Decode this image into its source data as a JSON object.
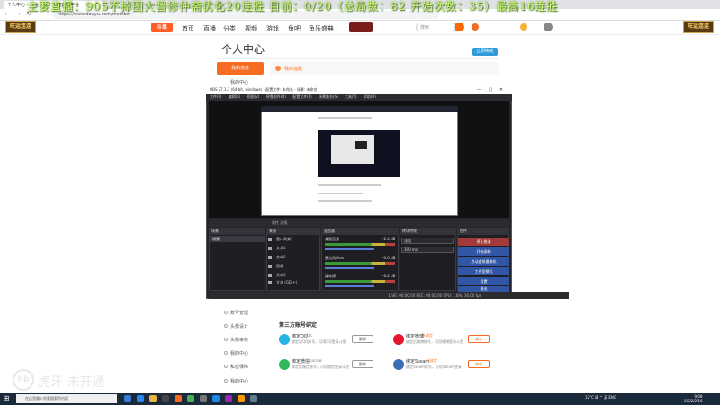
{
  "browser": {
    "tab_title": "个人中心 - 斗鱼 - 每个人的直播平台",
    "url": "https://www.douyu.com/member",
    "close_glyph": "✕",
    "back_glyph": "←",
    "forward_glyph": "→",
    "reload_glyph": "↻"
  },
  "overlay": {
    "text": "主要直播：905不掉图大督修仲斋优化20连胜  目前：0/20（总局数：82  开始次数：35）最高16连胜"
  },
  "site": {
    "logo": "斗鱼",
    "side_deco_left": "旺运连连",
    "side_deco_right": "旺运连连",
    "nav": [
      "首页",
      "直播",
      "分类",
      "视频",
      "游戏",
      "鱼吧",
      "鱼乐盛典"
    ],
    "search_placeholder": "搜索",
    "bind_phone": "立即绑定"
  },
  "page": {
    "title": "个人中心",
    "menu_button": "我的信息",
    "alert_text": "我的提醒",
    "side_menu": [
      "我的中心",
      "账号管理",
      "头像设计",
      "头像审核",
      "我的中心",
      "私密保障",
      "我的中心"
    ],
    "third_party_title": "第三方账号绑定",
    "bindings": [
      {
        "name": "绑定QQ",
        "sub": "Abc",
        "desc": "绑定后QQ账号，可用QQ登录斗鱼",
        "button": "解绑",
        "icon_color": "#27b4e8"
      },
      {
        "name": "绑定微博",
        "sub": "未绑定",
        "desc": "绑定后微博账号，可用微博登录斗鱼",
        "button": "绑定",
        "icon_color": "#e6162d"
      },
      {
        "name": "绑定微信",
        "sub": "sparrow",
        "desc": "绑定后微信账号，可用微信登录斗鱼",
        "button": "解绑",
        "icon_color": "#2fb85a"
      },
      {
        "name": "绑定Steam",
        "sub": "未绑定",
        "desc": "绑定Steam账号，可用Steam登录",
        "button": "绑定",
        "icon_color": "#3a6fb5"
      }
    ]
  },
  "obs": {
    "title": "OBS 27.1.3 (64-bit, windows) - 配置文件: 未命名 - 场景: 未命名",
    "menu": "文件(F) 编辑(E) 视图(V) 停靠部件(D) 配置文件(P) 场景集合(S) 工具(T) 帮助(H)",
    "toolbar": "属性   滤镜",
    "docks": {
      "scenes": "场景",
      "sources": "来源",
      "mixer": "混音器",
      "transitions": "转场特效",
      "controls": "控件"
    },
    "scene_item": "场景",
    "sources": [
      "窗口采集1",
      "文本1",
      "文本2",
      "图像",
      "文本3",
      "文本 (GDI+)"
    ],
    "mixer": [
      {
        "name": "桌面音频",
        "db": "-2.4 dB"
      },
      {
        "name": "麦克风/Aux",
        "db": "-0.0 dB"
      },
      {
        "name": "媒体源",
        "db": "-6.2 dB"
      }
    ],
    "transition": "淡出",
    "duration": "300 ms",
    "controls": [
      "停止推流",
      "开始录制",
      "启动虚拟摄像机",
      "工作室模式",
      "设置",
      "退出"
    ],
    "status": "LIVE: 00:00:00   REC: 00:00:00   CPU: 1.8%, 30.00 fps"
  },
  "taskbar": {
    "search": "在这里输入你要搜索的内容",
    "tray": "12°C  晴  ^  英  ENG",
    "time": "9:08",
    "date": "2022/2/16"
  },
  "watermark": {
    "logo": "hb",
    "text": "虎牙  未开通"
  }
}
